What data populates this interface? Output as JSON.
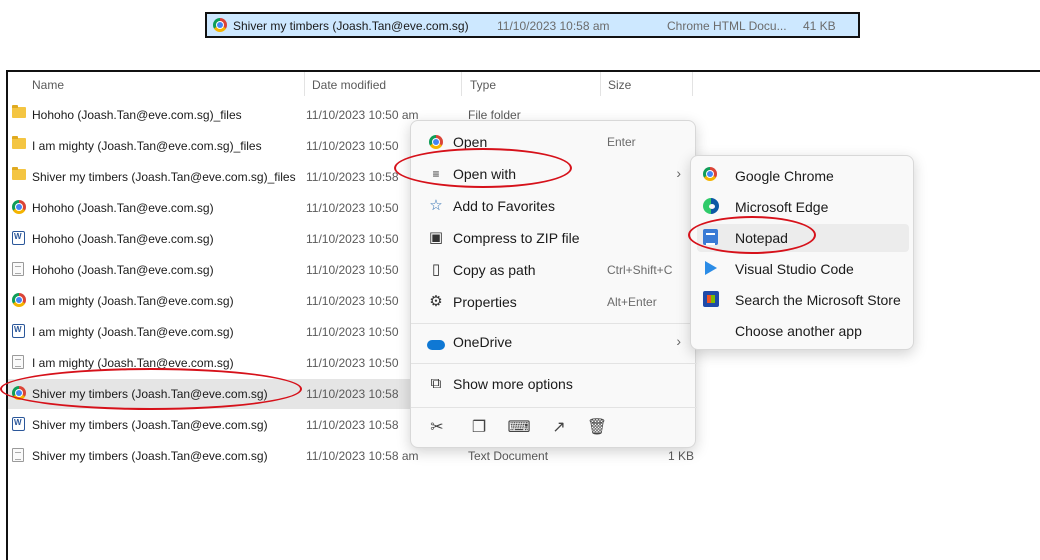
{
  "inset": {
    "name": "Shiver my timbers (Joash.Tan@eve.com.sg)",
    "date": "11/10/2023 10:58 am",
    "type": "Chrome HTML Docu...",
    "size": "41 KB"
  },
  "columns": {
    "name": "Name",
    "date": "Date modified",
    "type": "Type",
    "size": "Size"
  },
  "files": [
    {
      "name": "Hohoho (Joash.Tan@eve.com.sg)_files",
      "date": "11/10/2023 10:50 am",
      "type": "File folder",
      "size": "",
      "icon": "folder-icon"
    },
    {
      "name": "I am mighty (Joash.Tan@eve.com.sg)_files",
      "date": "11/10/2023 10:50",
      "type": "",
      "size": "",
      "icon": "folder-icon"
    },
    {
      "name": "Shiver my timbers (Joash.Tan@eve.com.sg)_files",
      "date": "11/10/2023 10:58",
      "type": "",
      "size": "",
      "icon": "folder-icon"
    },
    {
      "name": "Hohoho (Joash.Tan@eve.com.sg)",
      "date": "11/10/2023 10:50",
      "type": "",
      "size": "",
      "icon": "chrome-icon"
    },
    {
      "name": "Hohoho (Joash.Tan@eve.com.sg)",
      "date": "11/10/2023 10:50",
      "type": "",
      "size": "",
      "icon": "word-doc-icon"
    },
    {
      "name": "Hohoho (Joash.Tan@eve.com.sg)",
      "date": "11/10/2023 10:50",
      "type": "",
      "size": "",
      "icon": "text-file-icon"
    },
    {
      "name": "I am mighty (Joash.Tan@eve.com.sg)",
      "date": "11/10/2023 10:50",
      "type": "",
      "size": "",
      "icon": "chrome-icon"
    },
    {
      "name": "I am mighty (Joash.Tan@eve.com.sg)",
      "date": "11/10/2023 10:50",
      "type": "",
      "size": "",
      "icon": "word-doc-icon"
    },
    {
      "name": "I am mighty (Joash.Tan@eve.com.sg)",
      "date": "11/10/2023 10:50",
      "type": "",
      "size": "",
      "icon": "text-file-icon"
    },
    {
      "name": "Shiver my timbers (Joash.Tan@eve.com.sg)",
      "date": "11/10/2023 10:58",
      "type": "",
      "size": "",
      "icon": "chrome-icon",
      "selected": true
    },
    {
      "name": "Shiver my timbers (Joash.Tan@eve.com.sg)",
      "date": "11/10/2023 10:58",
      "type": "",
      "size": "",
      "icon": "word-doc-icon"
    },
    {
      "name": "Shiver my timbers (Joash.Tan@eve.com.sg)",
      "date": "11/10/2023 10:58 am",
      "type": "Text Document",
      "size": "1 KB",
      "icon": "text-file-icon"
    }
  ],
  "context_menu": {
    "items": [
      {
        "label": "Open",
        "shortcut": "Enter",
        "icon": "chrome-icon"
      },
      {
        "label": "Open with",
        "shortcut": "",
        "icon": "open-with-icon",
        "submenu": true
      },
      {
        "label": "Add to Favorites",
        "shortcut": "",
        "icon": "star-icon"
      },
      {
        "label": "Compress to ZIP file",
        "shortcut": "",
        "icon": "zip-icon"
      },
      {
        "label": "Copy as path",
        "shortcut": "Ctrl+Shift+C",
        "icon": "copy-path-icon"
      },
      {
        "label": "Properties",
        "shortcut": "Alt+Enter",
        "icon": "wrench-icon"
      },
      {
        "label": "OneDrive",
        "shortcut": "",
        "icon": "cloud-icon",
        "submenu": true
      },
      {
        "label": "Show more options",
        "shortcut": "",
        "icon": "share-window-icon"
      }
    ],
    "quick_actions": [
      "cut-icon",
      "copy-icon",
      "rename-icon",
      "share-icon",
      "delete-icon"
    ]
  },
  "open_with_menu": {
    "items": [
      {
        "label": "Google Chrome",
        "icon": "chrome-icon"
      },
      {
        "label": "Microsoft Edge",
        "icon": "edge-icon"
      },
      {
        "label": "Notepad",
        "icon": "notepad-icon",
        "highlighted": true
      },
      {
        "label": "Visual Studio Code",
        "icon": "vscode-icon"
      },
      {
        "label": "Search the Microsoft Store",
        "icon": "store-icon"
      },
      {
        "label": "Choose another app",
        "icon": ""
      }
    ]
  },
  "colors": {
    "selection": "#e5e5e5",
    "inset_selection": "#cde8ff",
    "annotation": "#d6111a"
  }
}
